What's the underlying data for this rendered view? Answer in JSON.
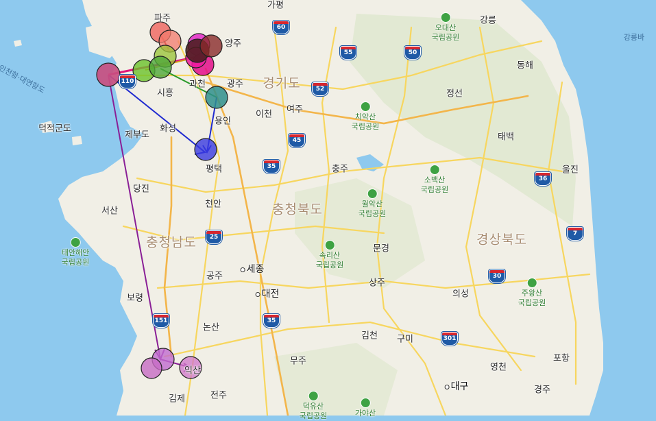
{
  "map": {
    "colors": {
      "land": "#f1efe6",
      "land_green": "#dfe8cf",
      "water": "#8ec9ee",
      "road": "#f7d65f",
      "road_major": "#f3b54a"
    },
    "province_labels": [
      {
        "id": "gyeonggi",
        "text": "경기도"
      },
      {
        "id": "chungbuk",
        "text": "충청북도"
      },
      {
        "id": "chungnam",
        "text": "충청남도"
      },
      {
        "id": "gyeongbuk",
        "text": "경상북도"
      }
    ],
    "city_labels": [
      {
        "id": "paju",
        "text": "파주"
      },
      {
        "id": "gapyeong",
        "text": "가평"
      },
      {
        "id": "yangju",
        "text": "양주"
      },
      {
        "id": "gangneung",
        "text": "강릉"
      },
      {
        "id": "donghae",
        "text": "동해"
      },
      {
        "id": "jeongseon",
        "text": "정선"
      },
      {
        "id": "taebaek",
        "text": "태백"
      },
      {
        "id": "uljin",
        "text": "울진"
      },
      {
        "id": "gwacheon",
        "text": "과천"
      },
      {
        "id": "gwangju",
        "text": "광주"
      },
      {
        "id": "siheung",
        "text": "시흥"
      },
      {
        "id": "icheon",
        "text": "이천"
      },
      {
        "id": "yeoju",
        "text": "여주"
      },
      {
        "id": "yongin",
        "text": "용인"
      },
      {
        "id": "hwaseong",
        "text": "화성"
      },
      {
        "id": "jebudo",
        "text": "제부도"
      },
      {
        "id": "deokjeok",
        "text": "덕적군도"
      },
      {
        "id": "pyeongtaek",
        "text": "평택"
      },
      {
        "id": "chungju",
        "text": "충주"
      },
      {
        "id": "dangjin",
        "text": "당진"
      },
      {
        "id": "seosan",
        "text": "서산"
      },
      {
        "id": "cheonan",
        "text": "천안"
      },
      {
        "id": "mungyeong",
        "text": "문경"
      },
      {
        "id": "gongju",
        "text": "공주"
      },
      {
        "id": "sangju",
        "text": "상주"
      },
      {
        "id": "boryeong",
        "text": "보령"
      },
      {
        "id": "uiseong",
        "text": "의성"
      },
      {
        "id": "nonsan",
        "text": "논산"
      },
      {
        "id": "gimcheon",
        "text": "김천"
      },
      {
        "id": "gumi",
        "text": "구미"
      },
      {
        "id": "muju",
        "text": "무주"
      },
      {
        "id": "yeongcheon",
        "text": "영천"
      },
      {
        "id": "pohang",
        "text": "포항"
      },
      {
        "id": "gyeongju",
        "text": "경주"
      },
      {
        "id": "gimje",
        "text": "김제"
      },
      {
        "id": "jeonju",
        "text": "전주"
      },
      {
        "id": "iksan",
        "text": "익산"
      }
    ],
    "major_cities": [
      {
        "id": "sejong",
        "text": "세종"
      },
      {
        "id": "daejeon",
        "text": "대전"
      },
      {
        "id": "daegu",
        "text": "대구"
      }
    ],
    "sea_labels": [
      {
        "id": "gangneung-en",
        "text": "강릉바"
      },
      {
        "id": "incheon-bridge",
        "text": "인천항·대연항도"
      }
    ],
    "parks": [
      {
        "id": "odaesan",
        "text1": "오대산",
        "text2": "국립공원"
      },
      {
        "id": "chiaksan",
        "text1": "치악산",
        "text2": "국립공원"
      },
      {
        "id": "sobaeksan",
        "text1": "소백산",
        "text2": "국립공원"
      },
      {
        "id": "woraksan",
        "text1": "월악산",
        "text2": "국립공원"
      },
      {
        "id": "taean",
        "text1": "태안해안",
        "text2": "국립공원"
      },
      {
        "id": "songnisan",
        "text1": "속리산",
        "text2": "국립공원"
      },
      {
        "id": "juwangsan",
        "text1": "주왕산",
        "text2": "국립공원"
      },
      {
        "id": "deogyusan",
        "text1": "덕유산",
        "text2": "국립공원"
      },
      {
        "id": "gayasan",
        "text1": "가야산",
        "text2": ""
      }
    ],
    "highway_shields": [
      {
        "id": "h60",
        "num": "60"
      },
      {
        "id": "h55",
        "num": "55"
      },
      {
        "id": "h50",
        "num": "50"
      },
      {
        "id": "h52",
        "num": "52"
      },
      {
        "id": "h45",
        "num": "45"
      },
      {
        "id": "h35a",
        "num": "35"
      },
      {
        "id": "h36",
        "num": "36"
      },
      {
        "id": "h7",
        "num": "7"
      },
      {
        "id": "h25",
        "num": "25"
      },
      {
        "id": "h30",
        "num": "30"
      },
      {
        "id": "h151",
        "num": "151"
      },
      {
        "id": "h35b",
        "num": "35"
      },
      {
        "id": "h301",
        "num": "301"
      },
      {
        "id": "h110",
        "num": "110"
      }
    ]
  }
}
